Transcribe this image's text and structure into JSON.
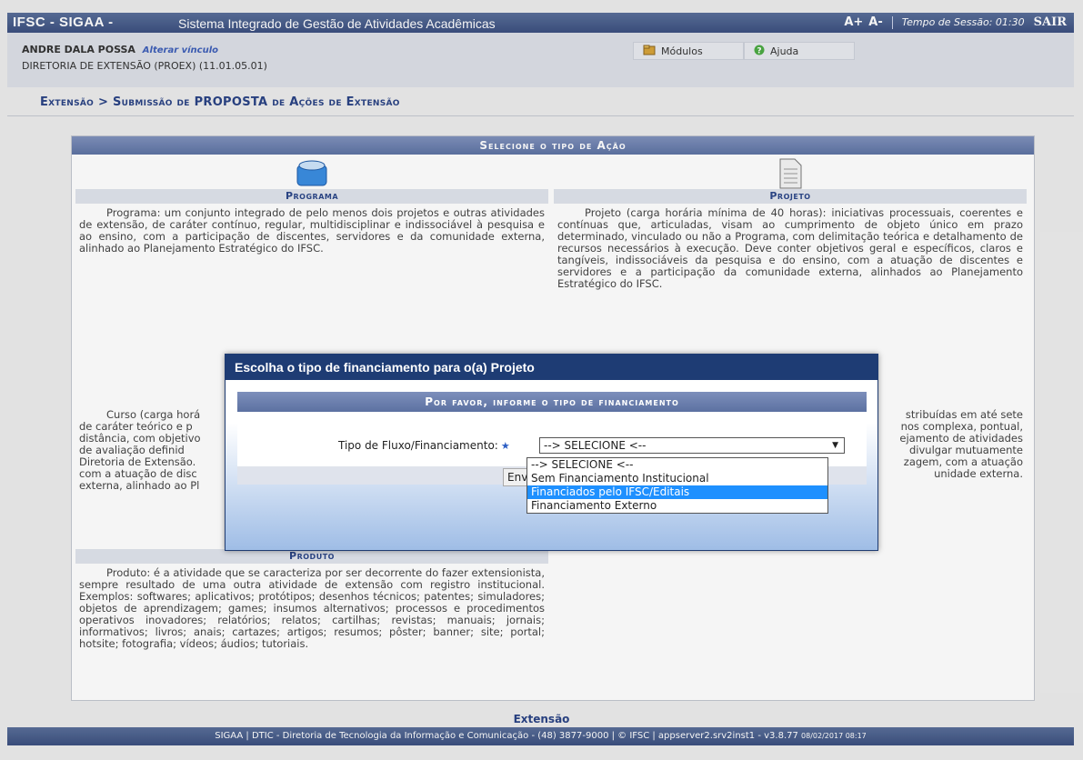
{
  "topbar": {
    "brand": "IFSC - SIGAA -",
    "system_name": "Sistema Integrado de Gestão de Atividades Acadêmicas",
    "font_increase": "A+",
    "font_decrease": "A-",
    "session": "Tempo de Sessão: 01:30",
    "logout": "SAIR"
  },
  "user": {
    "name": "ANDRE DALA POSSA",
    "change_link": "Alterar vínculo",
    "department": "DIRETORIA DE EXTENSÃO (PROEX) (11.01.05.01)"
  },
  "menu": {
    "modules": "Módulos",
    "help": "Ajuda"
  },
  "breadcrumb": "Extensão > Submissão de PROPOSTA de Ações de Extensão",
  "panel": {
    "title": "Selecione o tipo de Ação",
    "programa": {
      "title": "Programa",
      "desc": "Programa: um conjunto integrado de pelo menos dois projetos e outras atividades de extensão, de caráter contínuo, regular, multidisciplinar e indissociável à pesquisa e ao ensino, com a participação de discentes, servidores e da comunidade externa, alinhado ao Planejamento Estratégico do IFSC."
    },
    "projeto": {
      "title": "Projeto",
      "desc": "Projeto (carga horária mínima de 40 horas): iniciativas processuais, coerentes e contínuas que, articuladas, visam ao cumprimento de objeto único em prazo determinado, vinculado ou não a Programa, com delimitação teórica e detalhamento de recursos necessários à execução. Deve conter objetivos geral e específicos, claros e tangíveis, indissociáveis da pesquisa e do ensino, com a atuação de discentes e servidores e a participação da comunidade externa, alinhados ao Planejamento Estratégico do IFSC."
    },
    "curso": {
      "desc_lines": [
        "Curso (carga horá",
        "de caráter teórico e p",
        "distância, com objetivo",
        "de avaliação definid",
        "Diretoria de Extensão.",
        "com a atuação de disc",
        "externa, alinhado ao Pl"
      ]
    },
    "evento": {
      "desc_lines": [
        "stribuídas em até sete",
        "nos complexa, pontual,",
        "ejamento de atividades",
        "divulgar mutuamente",
        "zagem, com a atuação",
        "unidade externa."
      ]
    },
    "produto": {
      "title": "Produto",
      "desc": "Produto: é a atividade que se caracteriza por ser decorrente do fazer extensionista, sempre resultado de uma outra atividade de extensão com registro institucional. Exemplos: softwares; aplicativos; protótipos; desenhos técnicos; patentes; simuladores; objetos de aprendizagem; games; insumos alternativos; processos e procedimentos operativos inovadores; relatórios; relatos; cartilhas; revistas; manuais; jornais; informativos; livros; anais; cartazes; artigos; resumos; pôster; banner; site; portal; hotsite; fotografia; vídeos; áudios; tutoriais."
    }
  },
  "modal": {
    "title": "Escolha o tipo de financiamento para o(a) Projeto",
    "header": "Por favor, informe o tipo de financiamento",
    "field_label": "Tipo de Fluxo/Financiamento:",
    "required_mark": "★",
    "selected": "--> SELECIONE <--",
    "options": [
      "--> SELECIONE <--",
      "Sem Financiamento Institucional",
      "Financiados pelo IFSC/Editais",
      "Financiamento Externo"
    ],
    "highlighted_option": "Financiados pelo IFSC/Editais",
    "submit_partial": "Envia"
  },
  "footer": {
    "module": "Extensão",
    "text": "SIGAA | DTIC - Diretoria de Tecnologia da Informação e Comunicação - (48) 3877-9000 | © IFSC | appserver2.srv2inst1 - v3.8.77",
    "timestamp": "08/02/2017 08:17"
  },
  "colors": {
    "header_blue": "#3c5080",
    "modal_title": "#1e3c74",
    "highlight": "#1e90ff"
  }
}
